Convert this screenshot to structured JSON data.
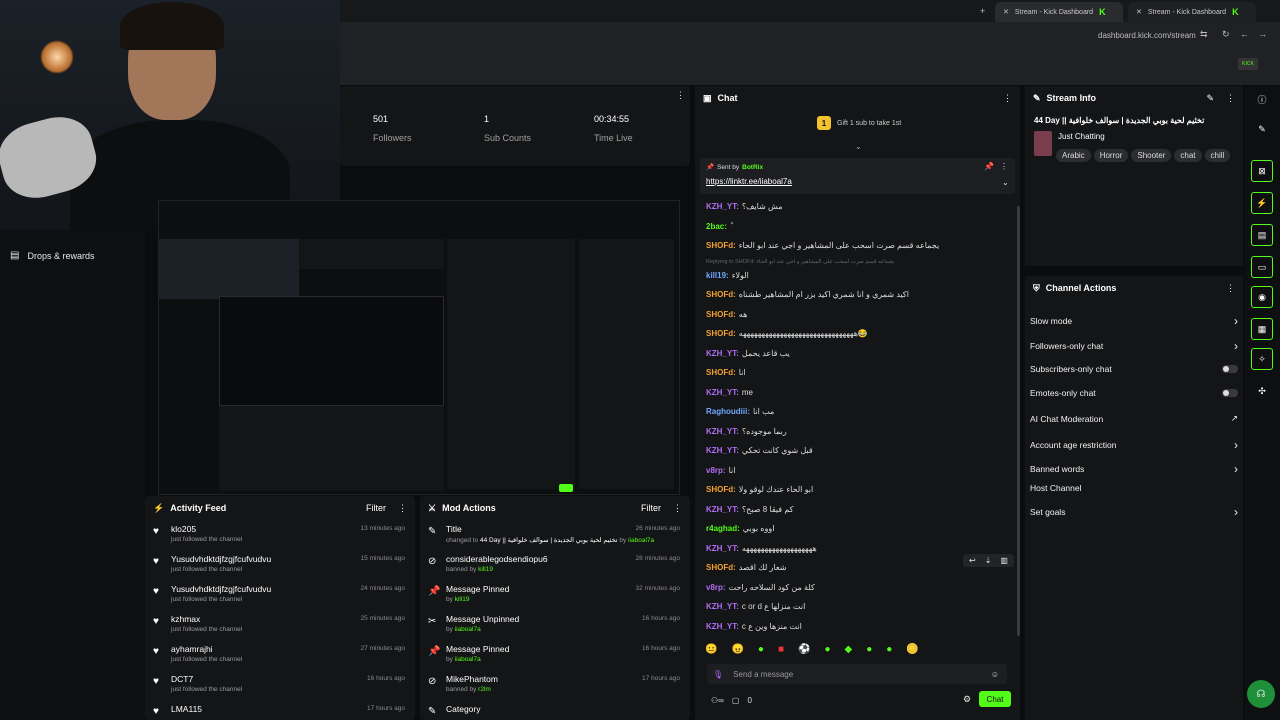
{
  "browser": {
    "tabs": [
      {
        "label": "Stream - Kick Dashboard"
      },
      {
        "label": "Stream - Kick Dashboard"
      }
    ],
    "url": "dashboard.kick.com/stream"
  },
  "sidebar": {
    "drops_label": "Drops & rewards"
  },
  "stats": {
    "followers_value": "501",
    "followers_label": "Followers",
    "subs_value": "1",
    "subs_label": "Sub Counts",
    "time_value": "00:34:55",
    "time_label": "Time Live"
  },
  "activity": {
    "title": "Activity Feed",
    "filter": "Filter",
    "items": [
      {
        "name": "klo205",
        "sub": "just followed the channel",
        "time": "13 minutes ago"
      },
      {
        "name": "Yusudvhdktdjfzgjfcufvudvu",
        "sub": "just followed the channel",
        "time": "15 minutes ago"
      },
      {
        "name": "Yusudvhdktdjfzgjfcufvudvu",
        "sub": "just followed the channel",
        "time": "24 minutes ago"
      },
      {
        "name": "kzhmax",
        "sub": "just followed the channel",
        "time": "25 minutes ago"
      },
      {
        "name": "ayhamrajhi",
        "sub": "just followed the channel",
        "time": "27 minutes ago"
      },
      {
        "name": "DCT7",
        "sub": "just followed the channel",
        "time": "16 hours ago"
      },
      {
        "name": "LMA115",
        "sub": "",
        "time": "17 hours ago"
      }
    ]
  },
  "mod": {
    "title": "Mod Actions",
    "filter": "Filter",
    "items": [
      {
        "name": "Title",
        "sub_pre": "changed to ",
        "sub_mid": "44 Day || تخثيم لحية بوبي الجديدة | سوالف خلوافية",
        "sub_post": " by ",
        "actor": "iiaboal7a",
        "time": "26 minutes ago",
        "icon": "edit-icon"
      },
      {
        "name": "considerablegodsendiopu6",
        "sub_pre": "banned by ",
        "sub_mid": "",
        "sub_post": "",
        "actor": "kill19",
        "time": "28 minutes ago",
        "icon": "ban-icon"
      },
      {
        "name": "Message Pinned",
        "sub_pre": "by ",
        "sub_mid": "",
        "sub_post": "",
        "actor": "kill19",
        "time": "32 minutes ago",
        "icon": "pin-icon"
      },
      {
        "name": "Message Unpinned",
        "sub_pre": "by ",
        "sub_mid": "",
        "sub_post": "",
        "actor": "iiaboal7a",
        "time": "16 hours ago",
        "icon": "unpin-icon"
      },
      {
        "name": "Message Pinned",
        "sub_pre": "by ",
        "sub_mid": "",
        "sub_post": "",
        "actor": "iiaboal7a",
        "time": "16 hours ago",
        "icon": "pin-icon"
      },
      {
        "name": "MikePhantom",
        "sub_pre": "banned by ",
        "sub_mid": "",
        "sub_post": "",
        "actor": "r2lm",
        "time": "17 hours ago",
        "icon": "ban-icon"
      },
      {
        "name": "Category",
        "sub_pre": "",
        "sub_mid": "",
        "sub_post": "",
        "actor": "",
        "time": "",
        "icon": "edit-icon"
      }
    ]
  },
  "chat": {
    "title": "Chat",
    "gift_text": "Gift 1 sub to take 1st",
    "gift_rank": "1",
    "pinned_sent_by": "Sent by",
    "pinned_user": "BotRix",
    "pinned_link": "https://linktr.ee/iiaboal7a",
    "reply_text": "Replying to SHOFd: يجماعه قسم صرت اسحب على المشاهير و اجي عند ابو الحاء",
    "messages": [
      {
        "user": "KZH_YT:",
        "text": "مش شايف؟",
        "color": "#b06cf4"
      },
      {
        "user": "2bac:",
        "text": "ً",
        "color": "#53fc18"
      },
      {
        "user": "SHOFd:",
        "text": "يجماعه قسم صرت اسحب على المشاهير و اجي عند ابو الحاء",
        "color": "#f4a12e"
      },
      {
        "user": "kill19:",
        "text": "الولاء",
        "color": "#6fa8ff"
      },
      {
        "user": "SHOFd:",
        "text": "اكيد شمري و انا شمري اكيد بزر ام المشاهير طشناه",
        "color": "#f4a12e"
      },
      {
        "user": "SHOFd:",
        "text": "هه",
        "color": "#f4a12e"
      },
      {
        "user": "SHOFd:",
        "text": "هههههههههههههههههههههههههههههههه😂",
        "color": "#f4a12e"
      },
      {
        "user": "KZH_YT:",
        "text": "يب قاعد يحمل",
        "color": "#b06cf4"
      },
      {
        "user": "SHOFd:",
        "text": "انا",
        "color": "#f4a12e"
      },
      {
        "user": "KZH_YT:",
        "text": "me",
        "color": "#b06cf4"
      },
      {
        "user": "Raghoudiii:",
        "text": "مب انا",
        "color": "#6fa8ff"
      },
      {
        "user": "KZH_YT:",
        "text": "ربما موجوده؟",
        "color": "#b06cf4"
      },
      {
        "user": "KZH_YT:",
        "text": "قبل شوي كانت تحكي",
        "color": "#b06cf4"
      },
      {
        "user": "v8rp:",
        "text": "انا",
        "color": "#b06cf4"
      },
      {
        "user": "SHOFd:",
        "text": "ابو الحاء عندك لوقو ولا",
        "color": "#f4a12e"
      },
      {
        "user": "KZH_YT:",
        "text": "كم فيقا 8 صبح؟",
        "color": "#b06cf4"
      },
      {
        "user": "r4aghad:",
        "text": "اووه بوبي",
        "color": "#53fc18"
      },
      {
        "user": "KZH_YT:",
        "text": "هههههههههههههههههههه",
        "color": "#b06cf4"
      },
      {
        "user": "SHOFd:",
        "text": "شعار لك اقصد",
        "color": "#f4a12e"
      },
      {
        "user": "v8rp:",
        "text": "كلة من كود السلاحه راحت",
        "color": "#b06cf4"
      },
      {
        "user": "KZH_YT:",
        "text": "c or d انت منزلها ع",
        "color": "#b06cf4"
      },
      {
        "user": "KZH_YT:",
        "text": "c انت منزها وين ع",
        "color": "#b06cf4"
      }
    ],
    "input_placeholder": "Send a message",
    "viewer_count": "0",
    "send_label": "Chat"
  },
  "stream_info": {
    "title": "Stream Info",
    "stream_title": "44 Day || تخثيم لحية بوبي الجديدة | سوالف خلوافية",
    "category": "Just Chatting",
    "tags": [
      "Arabic",
      "Horror",
      "Shooter",
      "chat",
      "chill"
    ]
  },
  "channel_actions": {
    "title": "Channel Actions",
    "items": [
      {
        "label": "Slow mode",
        "control": "chevron"
      },
      {
        "label": "Followers-only chat",
        "control": "chevron"
      },
      {
        "label": "Subscribers-only chat",
        "control": "toggle"
      },
      {
        "label": "Emotes-only chat",
        "control": "toggle"
      },
      {
        "label": "AI Chat Moderation",
        "control": "external"
      },
      {
        "label": "Account age restriction",
        "control": "chevron"
      },
      {
        "label": "Banned words",
        "control": "chevron"
      },
      {
        "label": "Host Channel",
        "control": "none"
      },
      {
        "label": "Set goals",
        "control": "chevron"
      }
    ]
  },
  "colors": {
    "brand": "#53fc18",
    "panel": "#141517",
    "bg": "#0b0c0e"
  }
}
